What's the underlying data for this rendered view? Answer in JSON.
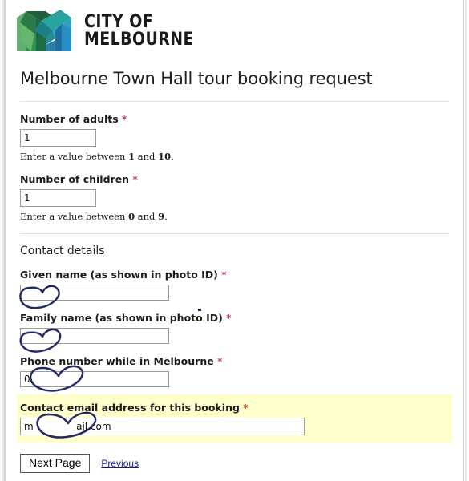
{
  "brand": {
    "logo_icon": "city-of-melbourne-m-logo",
    "line1": "CITY OF",
    "line2": "MELBOURNE",
    "colors": {
      "green_light": "#7ec37a",
      "green_mid": "#3f9b52",
      "green_dark": "#1d6b3c",
      "teal": "#2fa0a3",
      "teal_dark": "#1b7f86",
      "blue": "#2a8fc4",
      "blue_dark": "#1f6fa3"
    }
  },
  "page": {
    "title": "Melbourne Town Hall tour booking request"
  },
  "form": {
    "required_marker": "*",
    "adults": {
      "label": "Number of adults",
      "value": "1",
      "placeholder": "",
      "help_prefix": "Enter a value between ",
      "help_min": "1",
      "help_mid": " and ",
      "help_max": "10",
      "help_suffix": "."
    },
    "children": {
      "label": "Number of children",
      "value": "1",
      "placeholder": "",
      "help_prefix": "Enter a value between ",
      "help_min": "0",
      "help_mid": " and ",
      "help_max": "9",
      "help_suffix": "."
    },
    "contact_section_title": "Contact details",
    "given_name": {
      "label": "Given name (as shown in photo ID)",
      "value": "",
      "placeholder": ""
    },
    "family_name": {
      "label": "Family name (as shown in photo ID)",
      "value": "",
      "placeholder": ""
    },
    "phone": {
      "label": "Phone number while in Melbourne",
      "value": "0",
      "placeholder": ""
    },
    "email": {
      "label": "Contact email address for this booking",
      "value": "m              ail.com",
      "placeholder": "",
      "highlight_color": "#ffffcc"
    }
  },
  "footer": {
    "next_label": "Next Page",
    "previous_label": "Previous"
  },
  "annotations": {
    "redaction_color": "#232a63",
    "marks": [
      {
        "name": "given-name-redaction"
      },
      {
        "name": "family-name-redaction"
      },
      {
        "name": "phone-redaction"
      },
      {
        "name": "email-redaction"
      }
    ]
  }
}
